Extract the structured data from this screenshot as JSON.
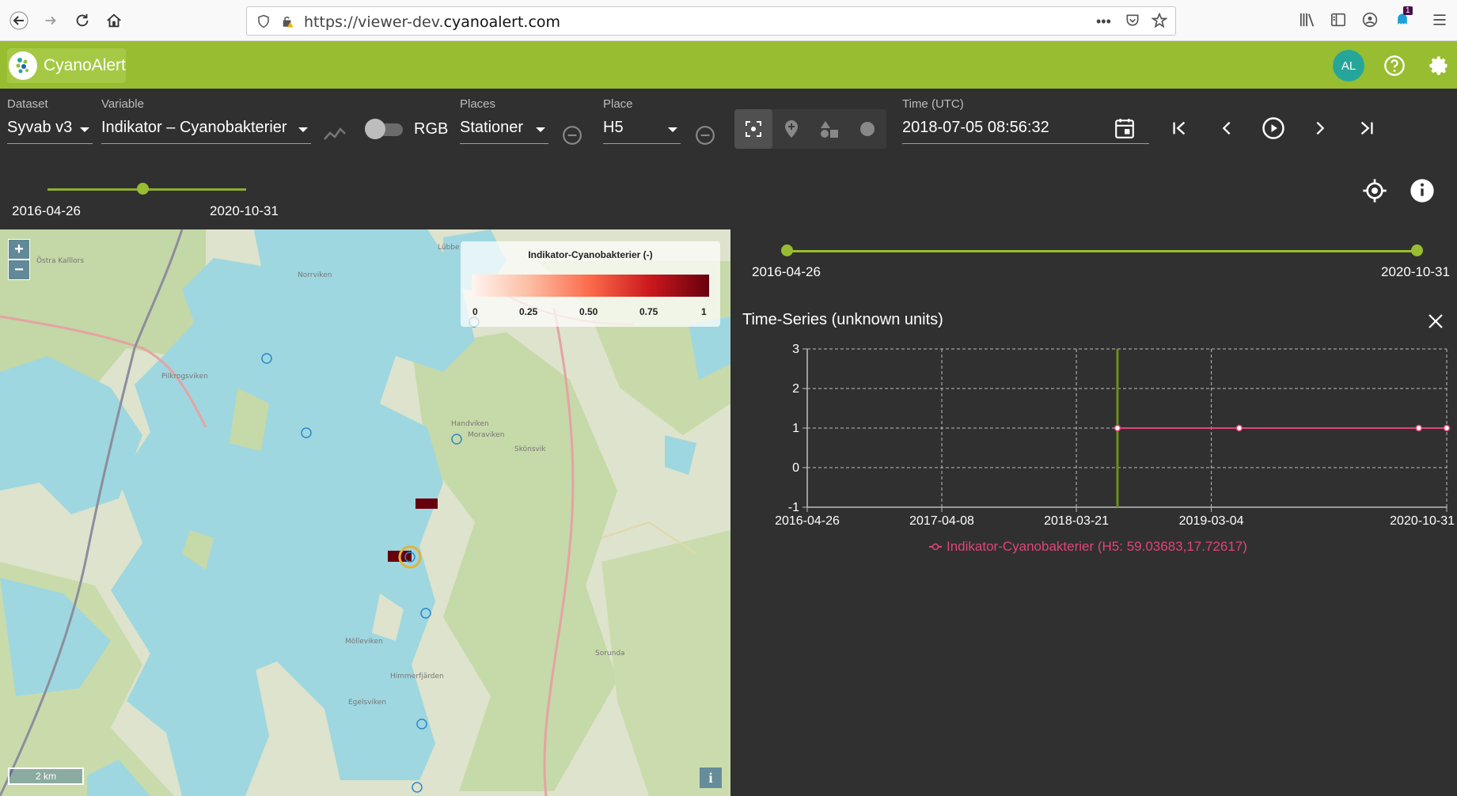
{
  "browser": {
    "url_prefix": "https://viewer-dev.",
    "url_domain": "cyanoalert.com",
    "badge_count": "1"
  },
  "app": {
    "name": "CyanoAlert",
    "avatar_initials": "AL"
  },
  "controls": {
    "dataset_label": "Dataset",
    "dataset_value": "Syvab v3",
    "variable_label": "Variable",
    "variable_value": "Indikator – Cyanobakterier",
    "rgb_label": "RGB",
    "places_label": "Places",
    "places_value": "Stationer",
    "place_label": "Place",
    "place_value": "H5",
    "time_label": "Time (UTC)",
    "time_value": "2018-07-05 08:56:32"
  },
  "time_slider": {
    "start": "2016-04-26",
    "end": "2020-10-31",
    "position": 0.48
  },
  "map": {
    "legend_title": "Indikator-Cyanobakterier (-)",
    "legend_ticks": [
      "0",
      "0.25",
      "0.50",
      "0.75",
      "1"
    ],
    "scale": "2 km",
    "place_names": [
      "Östra Kalllors",
      "Norrviken",
      "Pilkrogsviken",
      "Handviken",
      "Moraviken",
      "Skönsvik",
      "Mölleviken",
      "Himmerfjärden",
      "Egelsviken",
      "Sorunda",
      "Lübbe"
    ],
    "zoom_in": "+",
    "zoom_out": "−",
    "info": "i"
  },
  "timeseries": {
    "range_start": "2016-04-26",
    "range_end": "2020-10-31",
    "title": "Time-Series (unknown units)",
    "legend": "Indikator-Cyanobakterier (H5: 59.03683,17.72617)"
  },
  "chart_data": {
    "type": "line",
    "title": "Time-Series (unknown units)",
    "x_ticks": [
      "2016-04-26",
      "2017-04-08",
      "2018-03-21",
      "2019-03-04",
      "2020-10-31"
    ],
    "y_ticks": [
      "3",
      "2",
      "1",
      "0",
      "-1"
    ],
    "ylim": [
      -1,
      3
    ],
    "xlim": [
      "2016-04-26",
      "2020-10-31"
    ],
    "grid": true,
    "selected_time": "2018-07-05",
    "series": [
      {
        "name": "Indikator-Cyanobakterier (H5: 59.03683,17.72617)",
        "color": "#e0457b",
        "x": [
          "2018-07-05",
          "2019-05-15",
          "2020-08-20",
          "2020-10-31"
        ],
        "y": [
          1,
          1,
          1,
          1
        ]
      }
    ]
  }
}
